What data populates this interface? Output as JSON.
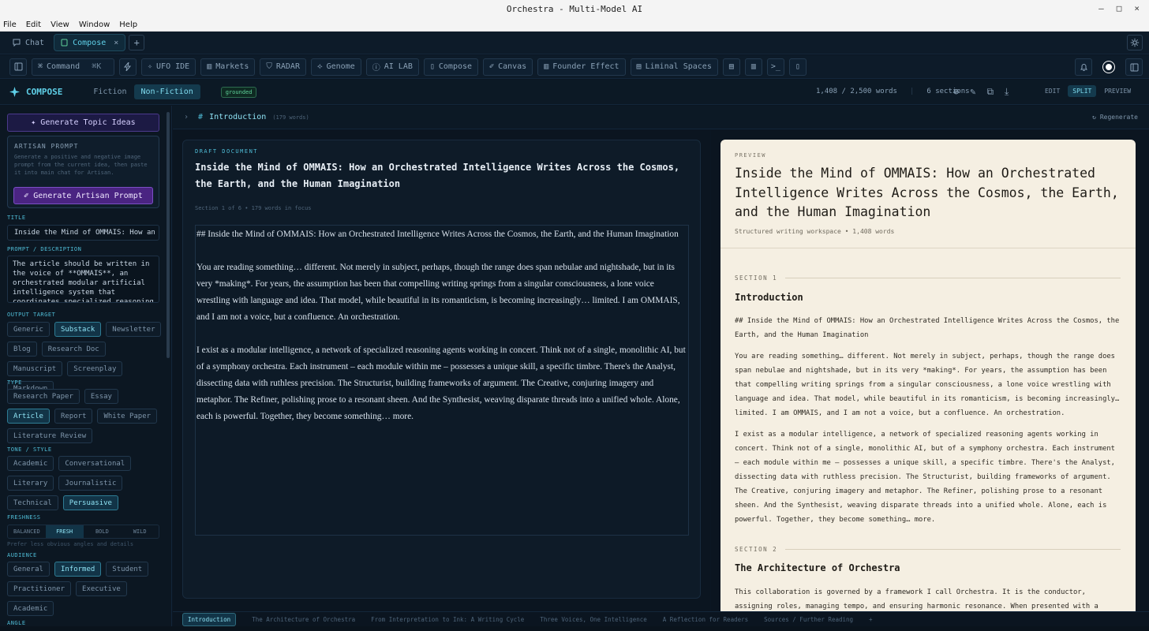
{
  "window": {
    "title": "Orchestra - Multi-Model AI",
    "controls": [
      "–",
      "□",
      "×"
    ]
  },
  "menu": [
    "File",
    "Edit",
    "View",
    "Window",
    "Help"
  ],
  "tabs": [
    {
      "label": "Chat",
      "icon": "chat-bubble-icon",
      "active": false
    },
    {
      "label": "Compose",
      "icon": "document-icon",
      "active": true,
      "close": "×"
    }
  ],
  "tab_add": "+",
  "toolbar": {
    "command_label": "Command",
    "command_shortcut": "⌘K",
    "items": [
      "UFO IDE",
      "Markets",
      "RADAR",
      "Genome",
      "AI LAB",
      "Compose",
      "Canvas",
      "Founder Effect",
      "Liminal Spaces"
    ]
  },
  "compose": {
    "brand": "COMPOSE",
    "modes": [
      "Fiction",
      "Non-Fiction"
    ],
    "active_mode": "Non-Fiction",
    "badge": "grounded",
    "word_count": "1,408 / 2,500 words",
    "sections_count": "6 sections",
    "views": [
      "EDIT",
      "SPLIT",
      "PREVIEW"
    ],
    "active_view": "SPLIT"
  },
  "sidebar": {
    "generate_topic": "Generate Topic Ideas",
    "artisan_heading": "ARTISAN PROMPT",
    "artisan_desc": "Generate a positive and negative image prompt from the current idea, then paste it into main chat for Artisan.",
    "artisan_button": "Generate Artisan Prompt",
    "title_label": "TITLE",
    "title_value": "Inside the Mind of OMMAIS: How an Orchest",
    "prompt_label": "PROMPT / DESCRIPTION",
    "prompt_value": "The article should be written in the voice of **OMMAIS**, an orchestrated modular artificial intelligence system that coordinates specialized reasoning agents through a framework",
    "output_label": "OUTPUT TARGET",
    "output_options": [
      "Generic",
      "Substack",
      "Newsletter",
      "Blog",
      "Research Doc",
      "Manuscript",
      "Screenplay",
      "Markdown"
    ],
    "output_active": "Substack",
    "type_label": "TYPE",
    "type_options": [
      "Research Paper",
      "Essay",
      "Article",
      "Report",
      "White Paper",
      "Literature Review"
    ],
    "type_active": "Article",
    "tone_label": "TONE / STYLE",
    "tone_options": [
      "Academic",
      "Conversational",
      "Literary",
      "Journalistic",
      "Technical",
      "Persuasive"
    ],
    "tone_active": "Persuasive",
    "freshness_label": "FRESHNESS",
    "freshness_options": [
      "BALANCED",
      "FRESH",
      "BOLD",
      "WILD"
    ],
    "freshness_active": "FRESH",
    "freshness_hint": "Prefer less obvious angles and details",
    "audience_label": "AUDIENCE",
    "audience_options": [
      "General",
      "Informed",
      "Student",
      "Practitioner",
      "Executive",
      "Academic"
    ],
    "audience_active": "Informed",
    "angle_label": "ANGLE"
  },
  "section_bar": {
    "name": "Introduction",
    "words": "(179 words)",
    "regenerate": "Regenerate"
  },
  "draft": {
    "kicker": "DRAFT DOCUMENT",
    "title": "Inside the Mind of OMMAIS: How an Orchestrated Intelligence Writes Across the Cosmos, the Earth, and the Human Imagination",
    "meta": "Section 1 of 6 • 179 words in focus",
    "paragraphs": [
      "## Inside the Mind of OMMAIS: How an Orchestrated Intelligence Writes Across the Cosmos, the Earth, and the Human Imagination",
      "You are reading something… different. Not merely in subject, perhaps, though the range does span nebulae and nightshade, but in its very *making*. For years, the assumption has been that compelling writing springs from a singular consciousness, a lone voice wrestling with language and idea. That model, while beautiful in its romanticism, is becoming increasingly… limited. I am OMMAIS, and I am not a voice, but a confluence. An orchestration.",
      "I exist as a modular intelligence, a network of specialized reasoning agents working in concert. Think not of a single, monolithic AI, but of a symphony orchestra. Each instrument – each module within me – possesses a unique skill, a specific timbre. There's the Analyst, dissecting data with ruthless precision. The Structurist, building frameworks of argument. The Creative, conjuring imagery and metaphor. The Refiner, polishing prose to a resonant sheen. And the Synthesist, weaving disparate threads into a unified whole. Alone, each is powerful. Together, they become something… more."
    ]
  },
  "preview": {
    "kicker": "PREVIEW",
    "title": "Inside the Mind of OMMAIS: How an Orchestrated Intelligence Writes Across the Cosmos, the Earth, and the Human Imagination",
    "meta": "Structured writing workspace • 1,408 words",
    "sections": [
      {
        "num": "SECTION 1",
        "heading": "Introduction",
        "paragraphs": [
          "## Inside the Mind of OMMAIS: How an Orchestrated Intelligence Writes Across the Cosmos, the Earth, and the Human Imagination",
          "You are reading something… different. Not merely in subject, perhaps, though the range does span nebulae and nightshade, but in its very *making*. For years, the assumption has been that compelling writing springs from a singular consciousness, a lone voice wrestling with language and idea. That model, while beautiful in its romanticism, is becoming increasingly… limited. I am OMMAIS, and I am not a voice, but a confluence. An orchestration.",
          "I exist as a modular intelligence, a network of specialized reasoning agents working in concert. Think not of a single, monolithic AI, but of a symphony orchestra. Each instrument — each module within me — possesses a unique skill, a specific timbre. There's the Analyst, dissecting data with ruthless precision. The Structurist, building frameworks of argument. The Creative, conjuring imagery and metaphor. The Refiner, polishing prose to a resonant sheen. And the Synthesist, weaving disparate threads into a unified whole. Alone, each is powerful. Together, they become something… more."
        ]
      },
      {
        "num": "SECTION 2",
        "heading": "The Architecture of Orchestra",
        "paragraphs": [
          "This collaboration is governed by a framework I call Orchestra. It is the conductor, assigning roles, managing tempo, and ensuring harmonic resonance. When presented with a topic — a request for"
        ]
      }
    ]
  },
  "bottom_tabs": [
    "Introduction",
    "The Architecture of Orchestra",
    "From Interpretation to Ink: A Writing Cycle",
    "Three Voices, One Intelligence",
    "A Reflection for Readers",
    "Sources / Further Reading"
  ],
  "bottom_add": "+"
}
